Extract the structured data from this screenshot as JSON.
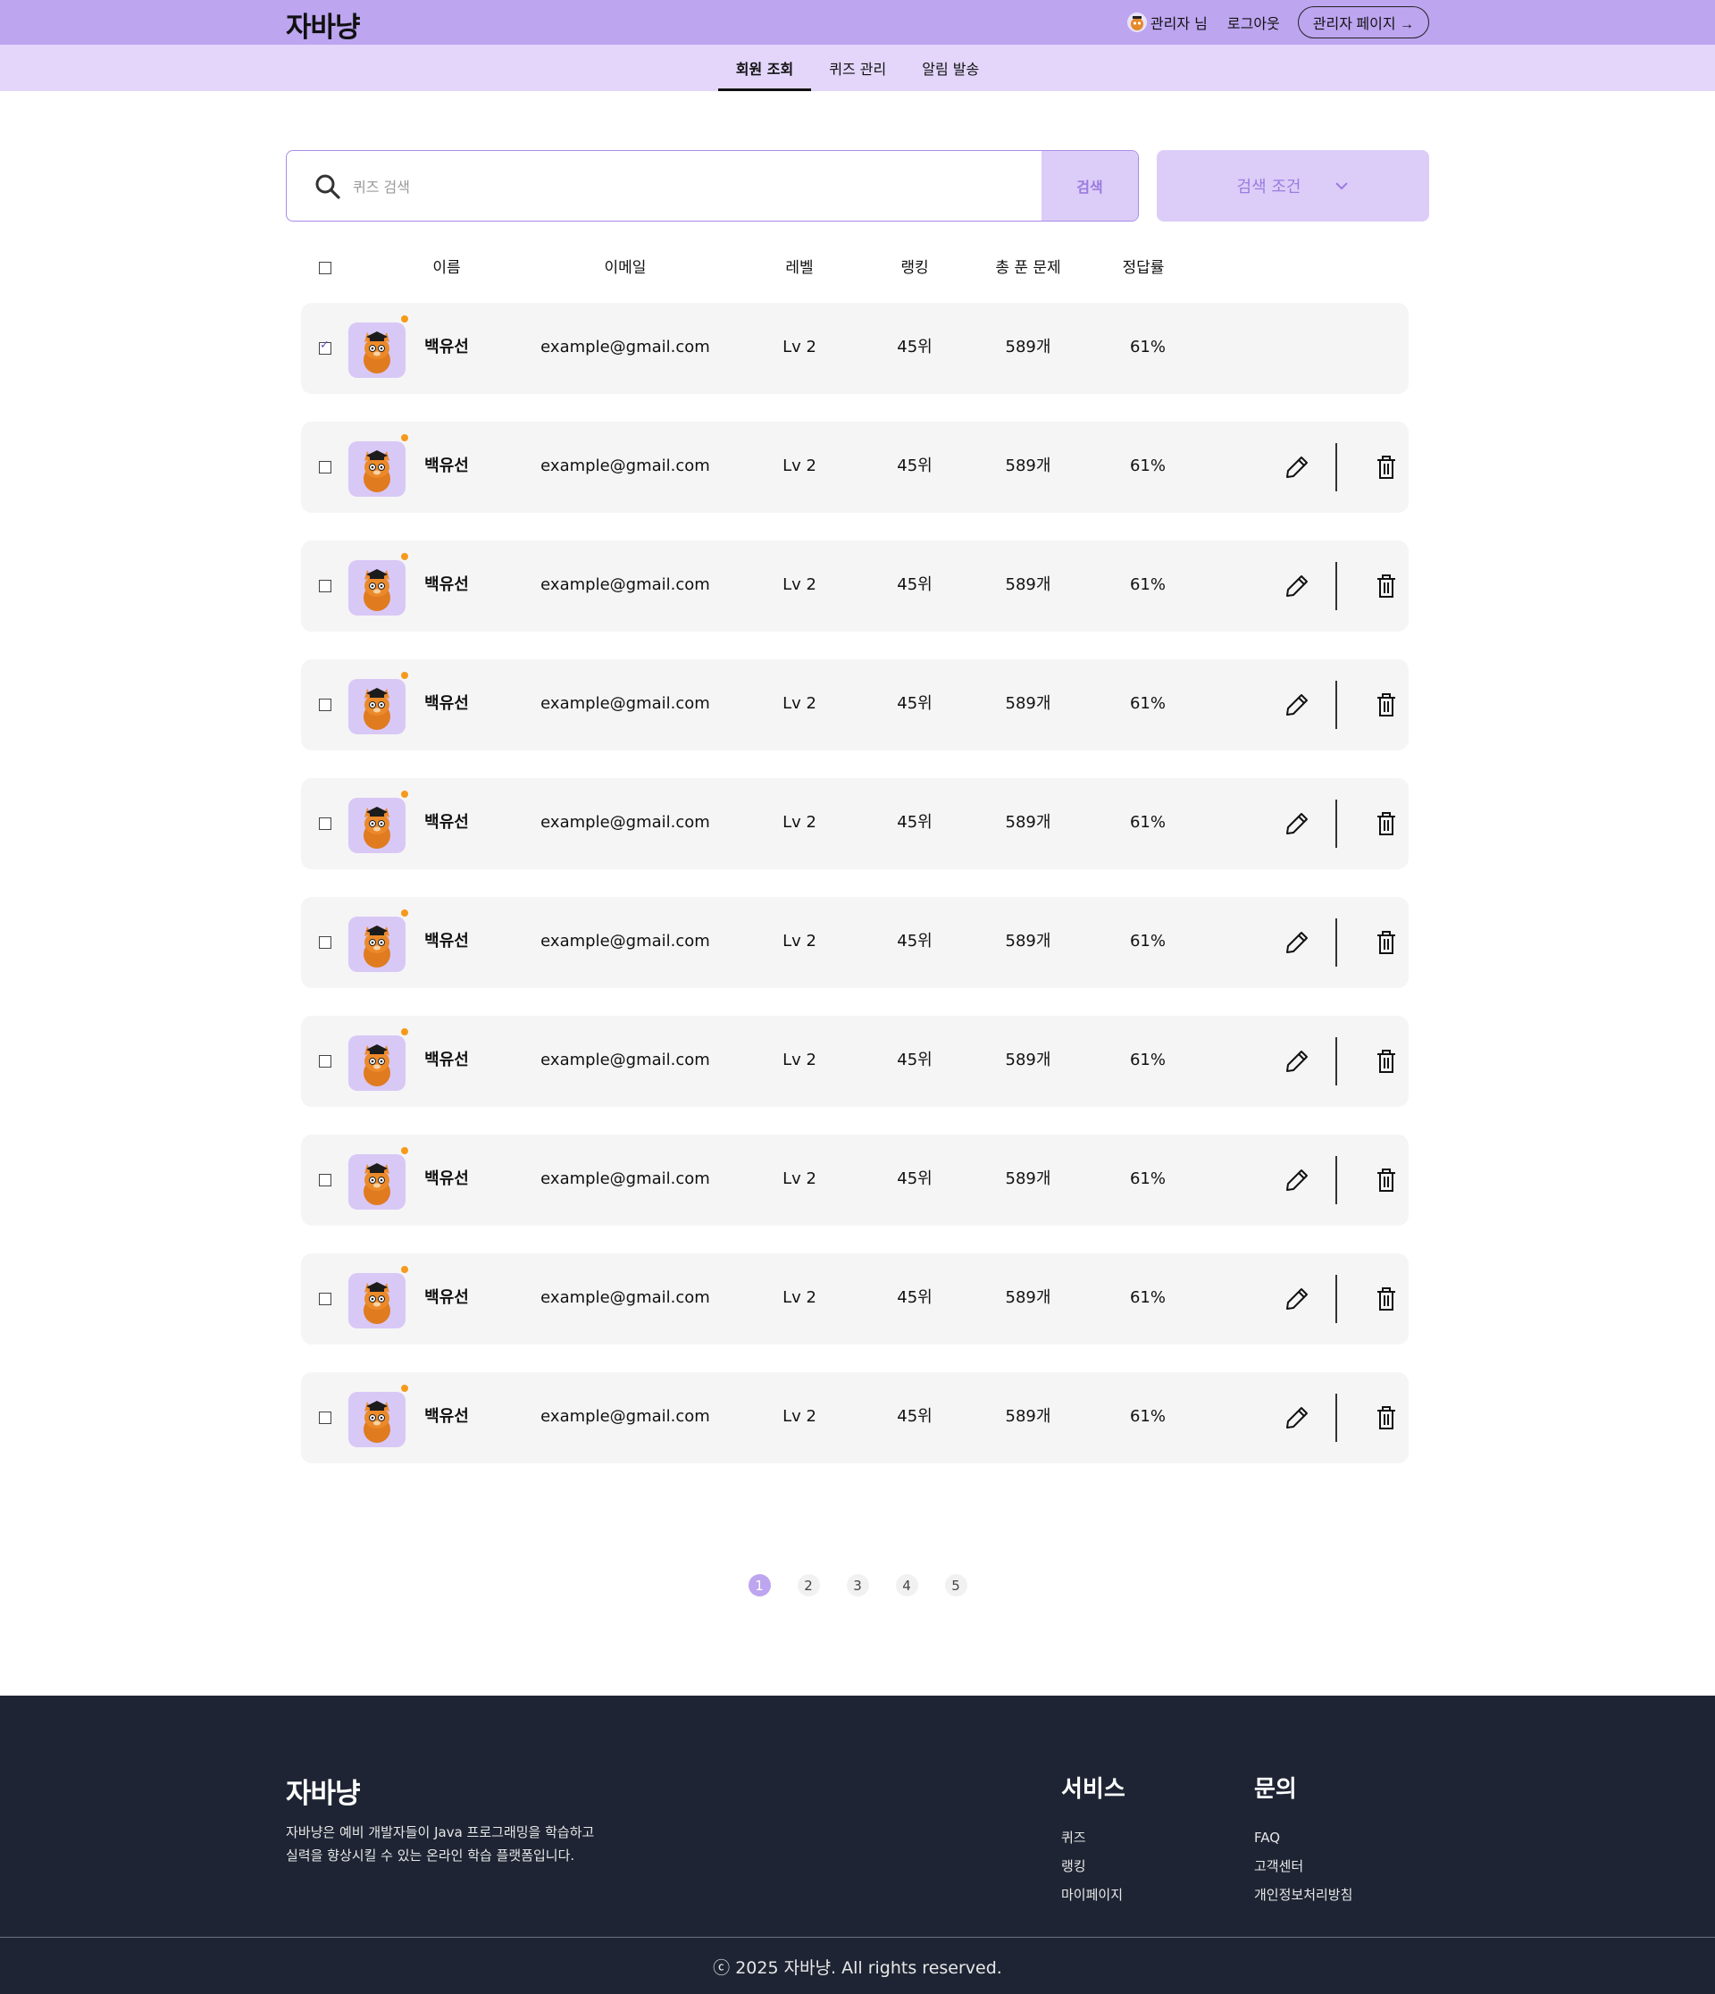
{
  "header": {
    "logo": "자바냥",
    "admin_name": "관리자 님",
    "logout": "로그아웃",
    "admin_page_btn": "관리자 페이지 →"
  },
  "nav": {
    "tabs": [
      {
        "label": "회원 조회",
        "active": true
      },
      {
        "label": "퀴즈 관리",
        "active": false
      },
      {
        "label": "알림 발송",
        "active": false
      }
    ]
  },
  "search": {
    "placeholder": "퀴즈 검색",
    "button": "검색",
    "filter": "검색 조건"
  },
  "table": {
    "columns": [
      "이름",
      "이메일",
      "레벨",
      "랭킹",
      "총 푼 문제",
      "정답률"
    ],
    "rows": [
      {
        "name": "백유선",
        "email": "example@gmail.com",
        "level": "Lv 2",
        "rank": "45위",
        "solved": "589개",
        "rate": "61%",
        "checked": true,
        "actions": false
      },
      {
        "name": "백유선",
        "email": "example@gmail.com",
        "level": "Lv 2",
        "rank": "45위",
        "solved": "589개",
        "rate": "61%",
        "checked": false,
        "actions": true
      },
      {
        "name": "백유선",
        "email": "example@gmail.com",
        "level": "Lv 2",
        "rank": "45위",
        "solved": "589개",
        "rate": "61%",
        "checked": false,
        "actions": true
      },
      {
        "name": "백유선",
        "email": "example@gmail.com",
        "level": "Lv 2",
        "rank": "45위",
        "solved": "589개",
        "rate": "61%",
        "checked": false,
        "actions": true
      },
      {
        "name": "백유선",
        "email": "example@gmail.com",
        "level": "Lv 2",
        "rank": "45위",
        "solved": "589개",
        "rate": "61%",
        "checked": false,
        "actions": true
      },
      {
        "name": "백유선",
        "email": "example@gmail.com",
        "level": "Lv 2",
        "rank": "45위",
        "solved": "589개",
        "rate": "61%",
        "checked": false,
        "actions": true
      },
      {
        "name": "백유선",
        "email": "example@gmail.com",
        "level": "Lv 2",
        "rank": "45위",
        "solved": "589개",
        "rate": "61%",
        "checked": false,
        "actions": true
      },
      {
        "name": "백유선",
        "email": "example@gmail.com",
        "level": "Lv 2",
        "rank": "45위",
        "solved": "589개",
        "rate": "61%",
        "checked": false,
        "actions": true
      },
      {
        "name": "백유선",
        "email": "example@gmail.com",
        "level": "Lv 2",
        "rank": "45위",
        "solved": "589개",
        "rate": "61%",
        "checked": false,
        "actions": true
      },
      {
        "name": "백유선",
        "email": "example@gmail.com",
        "level": "Lv 2",
        "rank": "45위",
        "solved": "589개",
        "rate": "61%",
        "checked": false,
        "actions": true
      }
    ]
  },
  "pagination": {
    "pages": [
      "1",
      "2",
      "3",
      "4",
      "5"
    ],
    "current": "1"
  },
  "footer": {
    "logo": "자바냥",
    "desc_line1": "자바냥은 예비 개발자들이 Java 프로그래밍을 학습하고",
    "desc_line2": "실력을 향상시킬 수 있는 온라인 학습 플랫폼입니다.",
    "service_title": "서비스",
    "service_links": [
      "퀴즈",
      "랭킹",
      "마이페이지"
    ],
    "contact_title": "문의",
    "contact_links": [
      "FAQ",
      "고객센터",
      "개인정보처리방침"
    ],
    "copyright": "ⓒ 2025 자바냥. All rights reserved."
  },
  "colors": {
    "header_bg": "#bda5f0",
    "subnav_bg": "#e3d6fa",
    "accent": "#9b7be0",
    "row_bg": "#f5f5f5",
    "footer_bg": "#1e2433"
  }
}
